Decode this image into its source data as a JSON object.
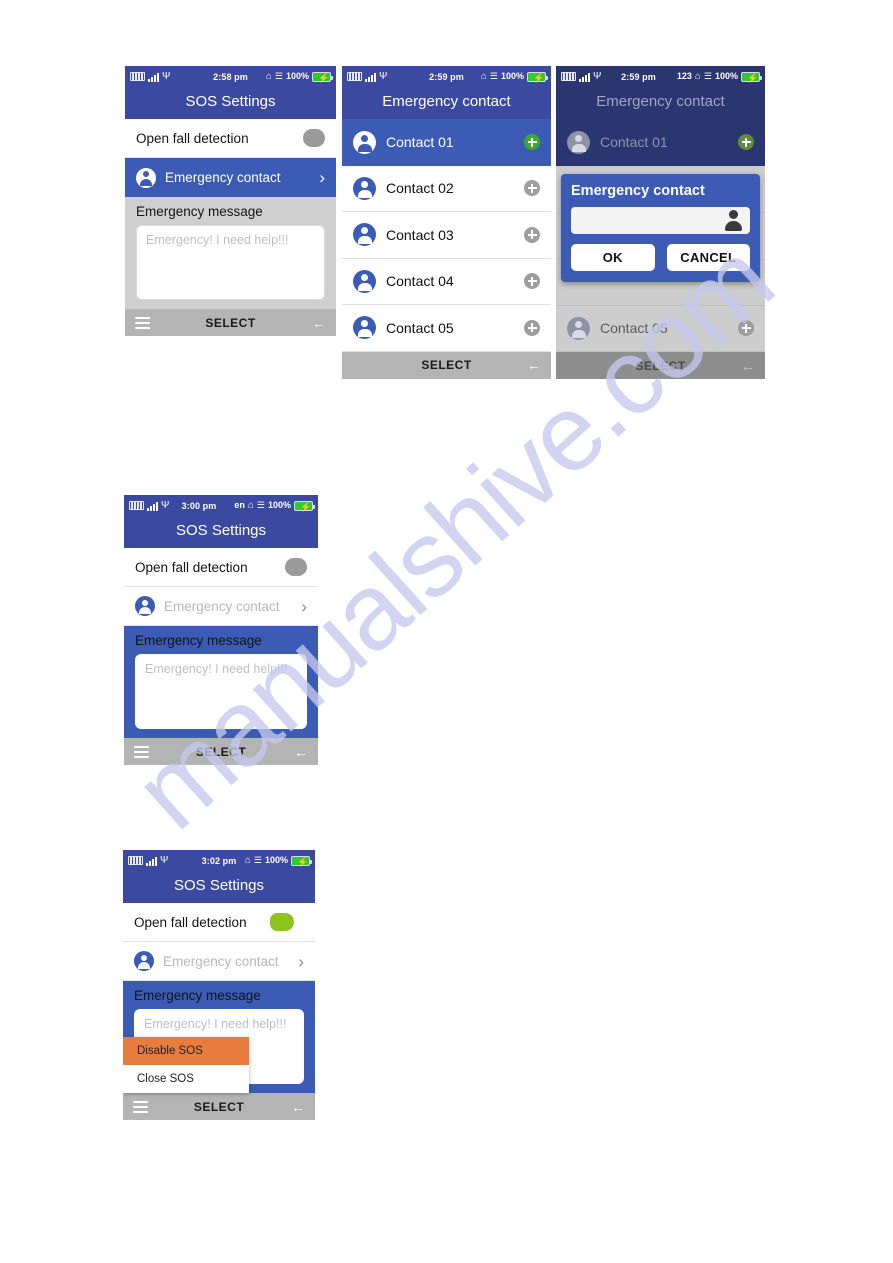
{
  "watermark": {
    "text": "manualshive.com"
  },
  "screens": [
    {
      "id": "sos-settings-1",
      "status": {
        "time": "2:58 pm",
        "battery": "100%",
        "ime": ""
      },
      "title": "SOS Settings",
      "fall_detection": {
        "label": "Open fall detection",
        "state": "off"
      },
      "emergency_contact": {
        "label": "Emergency contact",
        "selected": true
      },
      "message": {
        "title": "Emergency message",
        "placeholder": "Emergency! I need help!!!"
      },
      "nav": {
        "select": "SELECT"
      }
    },
    {
      "id": "emergency-contact-list",
      "status": {
        "time": "2:59 pm",
        "battery": "100%",
        "ime": ""
      },
      "title": "Emergency contact",
      "contacts": [
        {
          "label": "Contact 01",
          "selected": true
        },
        {
          "label": "Contact 02",
          "selected": false
        },
        {
          "label": "Contact 03",
          "selected": false
        },
        {
          "label": "Contact 04",
          "selected": false
        },
        {
          "label": "Contact 05",
          "selected": false
        }
      ],
      "nav": {
        "select": "SELECT"
      }
    },
    {
      "id": "emergency-contact-dialog",
      "status": {
        "time": "2:59 pm",
        "battery": "100%",
        "ime": "123"
      },
      "title": "Emergency contact",
      "contacts": [
        {
          "label": "Contact 01",
          "selected": true
        },
        {
          "label": "Contact 05",
          "selected": false
        }
      ],
      "dialog": {
        "title": "Emergency contact",
        "input_value": "",
        "ok_label": "OK",
        "cancel_label": "CANCEL"
      },
      "nav": {
        "select": "SELECT"
      }
    },
    {
      "id": "sos-settings-2",
      "status": {
        "time": "3:00 pm",
        "battery": "100%",
        "ime": "en"
      },
      "title": "SOS Settings",
      "fall_detection": {
        "label": "Open fall detection",
        "state": "off"
      },
      "emergency_contact": {
        "label": "Emergency contact",
        "selected": false
      },
      "message": {
        "title": "Emergency message",
        "placeholder": "Emergency! I need help!!!",
        "active": true
      },
      "nav": {
        "select": "SELECT"
      }
    },
    {
      "id": "sos-settings-3",
      "status": {
        "time": "3:02 pm",
        "battery": "100%",
        "ime": ""
      },
      "title": "SOS Settings",
      "fall_detection": {
        "label": "Open fall detection",
        "state": "on"
      },
      "emergency_contact": {
        "label": "Emergency contact",
        "selected": false
      },
      "message": {
        "title": "Emergency message",
        "placeholder": "Emergency! I need help!!!",
        "active": true
      },
      "menu": {
        "items": [
          {
            "label": "Disable SOS",
            "highlighted": true
          },
          {
            "label": "Close SOS",
            "highlighted": false
          }
        ]
      },
      "nav": {
        "select": "SELECT"
      }
    }
  ],
  "colors": {
    "brand_blue": "#3b4aa0",
    "row_blue": "#3b5bb5",
    "toggle_on_green": "#8cc41e",
    "plus_green": "#3ea834",
    "menu_highlight": "#e87c3e",
    "navbar_grey": "#b4b4b4",
    "battery_green": "#32c832"
  },
  "icons": {
    "sim": "sim-card-icon",
    "signal": "signal-bars-icon",
    "usb": "usb-icon",
    "bluetooth": "bluetooth-icon",
    "vibrate": "vibrate-icon",
    "battery": "battery-charging-icon",
    "hamburger": "hamburger-icon",
    "back": "back-arrow-icon",
    "chevron": "chevron-right-icon",
    "plus": "plus-circle-icon",
    "avatar": "contact-avatar-icon"
  }
}
